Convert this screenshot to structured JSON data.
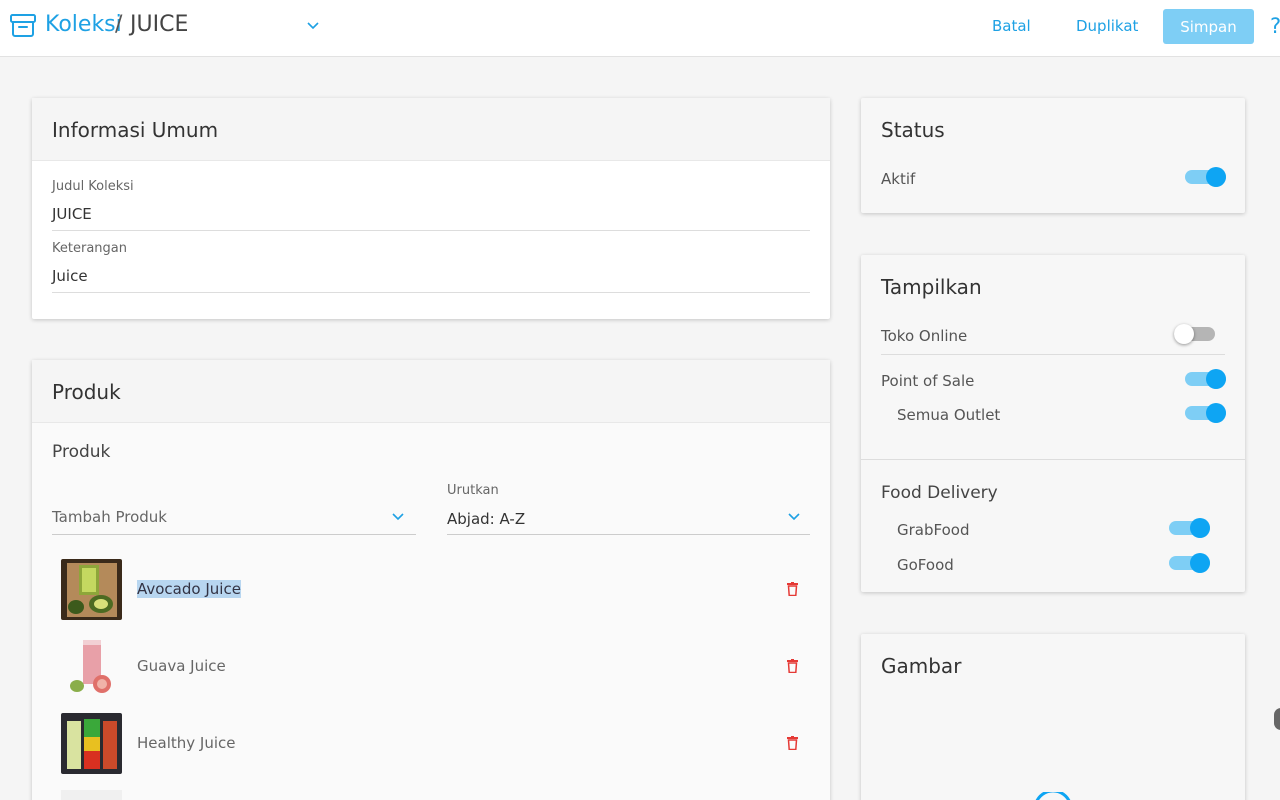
{
  "header": {
    "breadcrumb_link": "Koleksi",
    "breadcrumb_sep": "/",
    "breadcrumb_current": "JUICE",
    "cancel_label": "Batal",
    "duplicate_label": "Duplikat",
    "save_label": "Simpan",
    "help_label": "?"
  },
  "general": {
    "title": "Informasi Umum",
    "collection_title_label": "Judul Koleksi",
    "collection_title_value": "JUICE",
    "description_label": "Keterangan",
    "description_value": "Juice"
  },
  "products": {
    "title": "Produk",
    "subtitle": "Produk",
    "add_placeholder": "Tambah Produk",
    "sort_label": "Urutkan",
    "sort_value": "Abjad: A-Z",
    "items": [
      {
        "name": "Avocado Juice",
        "selected": true
      },
      {
        "name": "Guava Juice",
        "selected": false
      },
      {
        "name": "Healthy Juice",
        "selected": false
      }
    ]
  },
  "status": {
    "title": "Status",
    "active_label": "Aktif",
    "active_on": true
  },
  "display": {
    "title": "Tampilkan",
    "online_store_label": "Toko Online",
    "online_store_on": false,
    "pos_label": "Point of Sale",
    "pos_on": true,
    "all_outlets_label": "Semua Outlet",
    "all_outlets_on": true,
    "food_delivery_label": "Food Delivery",
    "grabfood_label": "GrabFood",
    "grabfood_on": true,
    "gofood_label": "GoFood",
    "gofood_on": true
  },
  "image": {
    "title": "Gambar"
  },
  "colors": {
    "accent": "#1ea1e4",
    "toggle_on": "#0ea5f3",
    "delete": "#e53935"
  }
}
